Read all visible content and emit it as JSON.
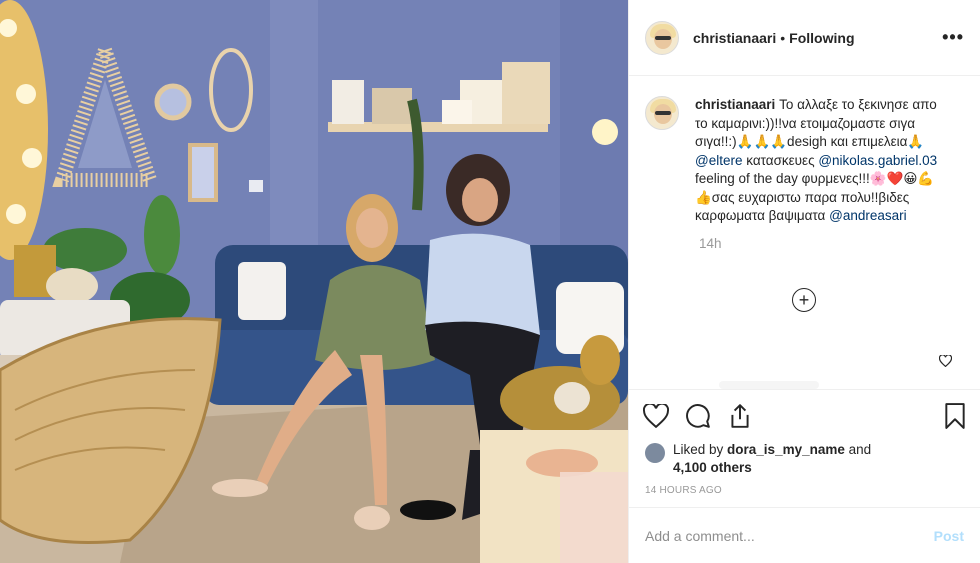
{
  "header": {
    "username": "christianaari",
    "separator": "•",
    "follow_status": "Following",
    "more_label": "•••"
  },
  "caption": {
    "username": "christianaari",
    "text_1": "Το αλλαξε το ξεκινησε απο το καμαρινι:))!!να ετοιμαζομαστε σιγα σιγα!!:)🙏🙏🙏desigh και επιμελεια🙏 ",
    "mention_1": "@eltere",
    "text_2": " κατασκευες ",
    "mention_2": "@nikolas.gabriel.03",
    "text_3": " feeling of the day φυρμενες!!!🌸❤️😀💪👍σας ευχαριστω παρα πολυ!!βιδες καρφωματα βαψιματα ",
    "mention_3": "@andreasari",
    "time": "14h"
  },
  "load_more_label": "+",
  "likes": {
    "prefix": "Liked by ",
    "user": "dora_is_my_name",
    "middle": " and",
    "count": "4,100 others"
  },
  "timestamp": "14 HOURS AGO",
  "comment_box": {
    "placeholder": "Add a comment...",
    "post_label": "Post"
  },
  "icons": [
    "heart-icon",
    "comment-icon",
    "share-icon",
    "bookmark-icon",
    "more-options-icon",
    "load-more-icon"
  ],
  "colors": {
    "link": "#003569",
    "post_button": "#b2dffc",
    "muted": "#999999",
    "wall": "#6f7fb2"
  }
}
